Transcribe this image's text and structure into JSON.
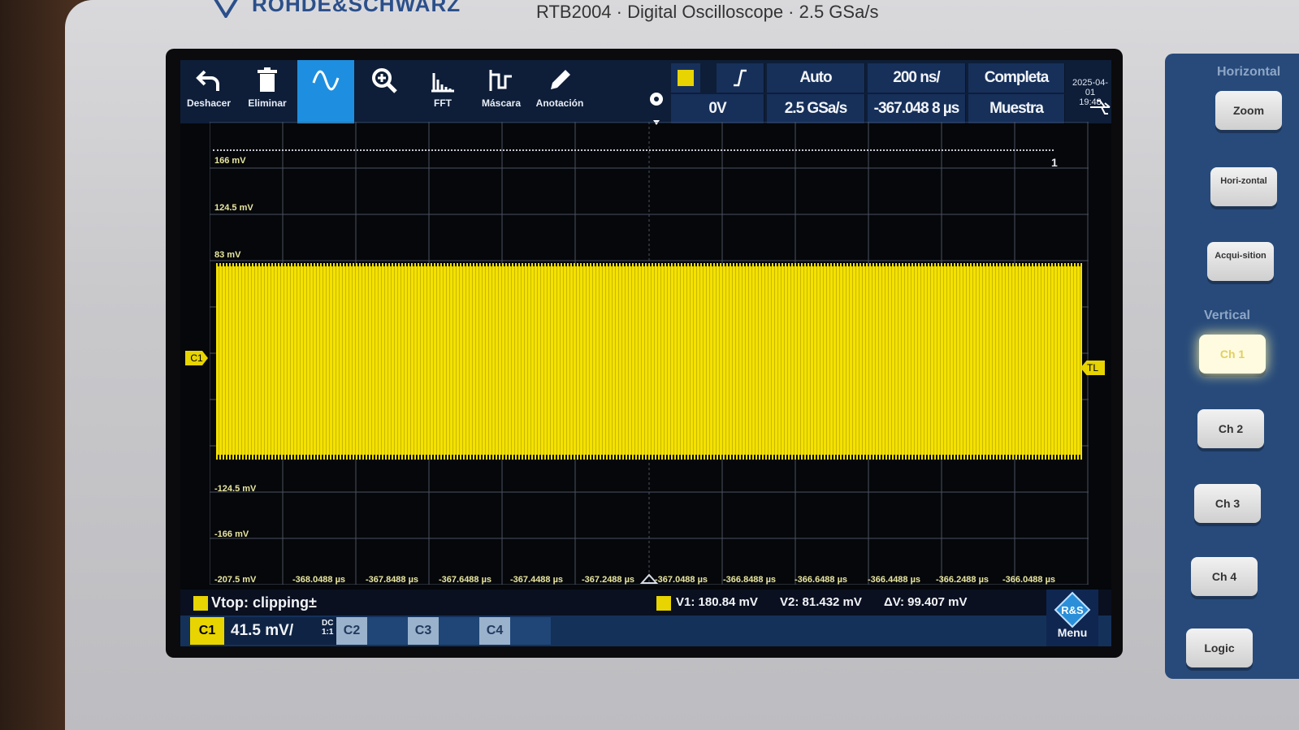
{
  "device": {
    "brand": "ROHDE&SCHWARZ",
    "model_line": "RTB2004 · Digital Oscilloscope · 2.5 GSa/s"
  },
  "toolbar": {
    "tools": [
      {
        "label": "Deshacer",
        "icon": "undo-icon"
      },
      {
        "label": "Eliminar",
        "icon": "trash-icon"
      },
      {
        "label": "",
        "icon": "waveform-icon"
      },
      {
        "label": "",
        "icon": "zoom-icon"
      },
      {
        "label": "FFT",
        "icon": "fft-icon"
      },
      {
        "label": "Máscara",
        "icon": "mask-icon"
      },
      {
        "label": "Anotación",
        "icon": "pencil-icon"
      }
    ]
  },
  "status": {
    "trigger_source": "C1",
    "trigger_slope": "rising-edge",
    "trigger_mode": "Auto",
    "trigger_level": "0V",
    "timebase": "200 ns/",
    "sample_rate": "2.5 GSa/s",
    "time_offset": "-367.048 8 µs",
    "acq_type": "Completa",
    "acq_mode": "Muestra",
    "date": "2025-04-01",
    "time": "19:48"
  },
  "grid": {
    "y_labels": [
      "166 mV",
      "124.5 mV",
      "83 mV",
      "-124.5 mV",
      "-166 mV",
      "-207.5 mV"
    ],
    "x_labels": [
      "-368.0488 µs",
      "-367.8488 µs",
      "-367.6488 µs",
      "-367.4488 µs",
      "-367.2488 µs",
      "-367.0488 µs",
      "-366.8488 µs",
      "-366.6488 µs",
      "-366.4488 µs",
      "-366.2488 µs",
      "-366.0488 µs"
    ],
    "c1_marker": "C1",
    "tl_marker": "TL",
    "ref_tag": "1"
  },
  "measure": {
    "clip_msg": "Vtop: clipping±",
    "v1": "V1: 180.84 mV",
    "v2": "V2: 81.432 mV",
    "dv": "ΔV: 99.407 mV"
  },
  "channels": {
    "c1": "C1",
    "c1_scale": "41.5 mV/",
    "c1_coupling": "DC",
    "c1_probe": "1:1",
    "c2": "C2",
    "c3": "C3",
    "c4": "C4",
    "menu": "Menu"
  },
  "side_panel": {
    "horizontal_header": "Horizontal",
    "zoom": "Zoom",
    "horizontal": "Hori-zontal",
    "acquisition": "Acqui-sition",
    "vertical_header": "Vertical",
    "ch1": "Ch 1",
    "ch2": "Ch 2",
    "ch3": "Ch 3",
    "ch4": "Ch 4",
    "logic": "Logic"
  }
}
